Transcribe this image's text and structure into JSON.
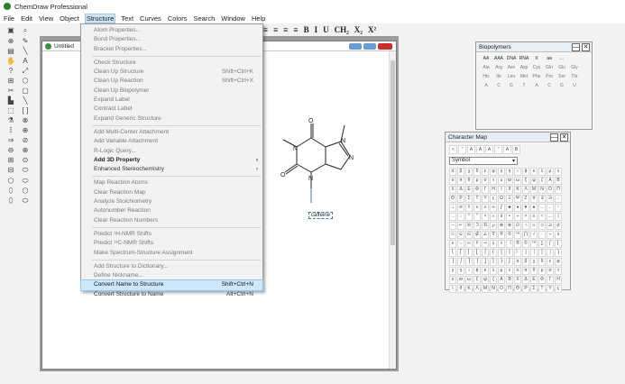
{
  "app": {
    "title": "ChemDraw Professional"
  },
  "menubar": [
    "File",
    "Edit",
    "View",
    "Object",
    "Structure",
    "Text",
    "Curves",
    "Colors",
    "Search",
    "Window",
    "Help"
  ],
  "menubar_active": "Structure",
  "format_toolbar": {
    "items": [
      "≡",
      "≡",
      "≡",
      "≡",
      "B",
      "I",
      "U",
      "CH₂",
      "X₂",
      "X²"
    ]
  },
  "document": {
    "title": "Untitled"
  },
  "structure_menu": {
    "groups": [
      [
        {
          "label": "Atom Properties...",
          "state": "disabled"
        },
        {
          "label": "Bond Properties...",
          "state": "disabled"
        },
        {
          "label": "Bracket Properties...",
          "state": "disabled"
        }
      ],
      [
        {
          "label": "Check Structure",
          "state": "disabled"
        },
        {
          "label": "Clean Up Structure",
          "shortcut": "Shift+Ctrl+K",
          "state": "disabled"
        },
        {
          "label": "Clean Up Reaction",
          "shortcut": "Shift+Ctrl+X",
          "state": "disabled"
        },
        {
          "label": "Clean Up Biopolymer",
          "state": "disabled"
        },
        {
          "label": "Expand Label",
          "state": "disabled"
        },
        {
          "label": "Contract Label",
          "state": "disabled"
        },
        {
          "label": "Expand Generic Structure",
          "state": "disabled"
        }
      ],
      [
        {
          "label": "Add Multi-Center Attachment",
          "state": "disabled"
        },
        {
          "label": "Add Variable Attachment",
          "state": "disabled"
        },
        {
          "label": "R-Logic Query...",
          "state": "disabled"
        },
        {
          "label": "Add 3D Property",
          "state": "bold",
          "submenu": true
        },
        {
          "label": "Enhanced Stereochemistry",
          "state": "normal",
          "submenu": true
        }
      ],
      [
        {
          "label": "Map Reaction Atoms",
          "state": "disabled"
        },
        {
          "label": "Clear Reaction Map",
          "state": "disabled"
        },
        {
          "label": "Analyze Stoichiometry",
          "state": "disabled"
        },
        {
          "label": "Autonumber Reaction",
          "state": "disabled"
        },
        {
          "label": "Clear Reaction Numbers",
          "state": "disabled"
        }
      ],
      [
        {
          "label": "Predict ¹H-NMR Shifts",
          "state": "disabled"
        },
        {
          "label": "Predict ¹³C-NMR Shifts",
          "state": "disabled"
        },
        {
          "label": "Make Spectrum-Structure Assignment",
          "state": "disabled"
        }
      ],
      [
        {
          "label": "Add Structure to Dictionary...",
          "state": "disabled"
        },
        {
          "label": "Define Nickname...",
          "state": "disabled"
        },
        {
          "label": "Convert Name to Structure",
          "shortcut": "Shift+Ctrl+N",
          "state": "selected"
        },
        {
          "label": "Convert Structure to Name",
          "shortcut": "Alt+Ctrl+N",
          "state": "normal"
        }
      ]
    ]
  },
  "molecule": {
    "atoms": [
      "O",
      "N",
      "N",
      "N",
      "N",
      "O"
    ],
    "name_label": "caffeine"
  },
  "biopolymers_panel": {
    "title": "Biopolymers",
    "rows": [
      [
        "AA",
        "AAA",
        "DNA",
        "RNA",
        "X",
        "aa",
        "..."
      ],
      [
        "Ala",
        "Arg",
        "Asn",
        "Asp",
        "Cys",
        "Gln",
        "Glu",
        "Gly"
      ],
      [
        "His",
        "Ile",
        "Leu",
        "Met",
        "Phe",
        "Pro",
        "Ser",
        "Thr"
      ],
      [
        "A",
        "C",
        "G",
        "T",
        "A",
        "C",
        "G",
        "U"
      ]
    ]
  },
  "charmap_panel": {
    "title": "Character Map",
    "font": "Symbol",
    "top_cells": [
      "<",
      "\"",
      "A",
      "A",
      "A",
      "\"",
      "A",
      "B"
    ]
  },
  "colors": {
    "menu_highlight": "#cde6fa",
    "workarea_gray": "#9c9c9c",
    "close_red": "#c9302c"
  }
}
